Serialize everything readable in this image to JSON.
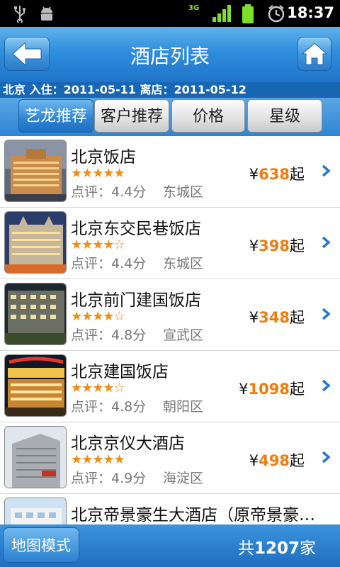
{
  "status_bar": {
    "time": "18:37",
    "network": "3G"
  },
  "header": {
    "title": "酒店列表"
  },
  "info": {
    "text": "北京 入住：2011-05-11 离店：2011-05-12"
  },
  "tabs": [
    {
      "label": "艺龙推荐",
      "active": true
    },
    {
      "label": "客户推荐",
      "active": false
    },
    {
      "label": "价格",
      "active": false
    },
    {
      "label": "星级",
      "active": false
    }
  ],
  "hotels": [
    {
      "name": "北京饭店",
      "stars": "★★★★★",
      "review": "点评：4.4分",
      "district": "东城区",
      "price_prefix": "¥",
      "price": "638",
      "price_suffix": "起"
    },
    {
      "name": "北京东交民巷饭店",
      "stars": "★★★★☆",
      "review": "点评：4.4分",
      "district": "东城区",
      "price_prefix": "¥",
      "price": "398",
      "price_suffix": "起"
    },
    {
      "name": "北京前门建国饭店",
      "stars": "★★★★☆",
      "review": "点评：4.8分",
      "district": "宣武区",
      "price_prefix": "¥",
      "price": "348",
      "price_suffix": "起"
    },
    {
      "name": "北京建国饭店",
      "stars": "★★★★☆",
      "review": "点评：4.8分",
      "district": "朝阳区",
      "price_prefix": "¥",
      "price": "1098",
      "price_suffix": "起"
    },
    {
      "name": "北京京仪大酒店",
      "stars": "★★★★★",
      "review": "点评：4.9分",
      "district": "海淀区",
      "price_prefix": "¥",
      "price": "498",
      "price_suffix": "起"
    },
    {
      "name": "北京帝景豪生大酒店（原帝景豪…"
    }
  ],
  "footer": {
    "map_button": "地图模式",
    "total_prefix": "共",
    "total_count": "1207",
    "total_suffix": "家"
  },
  "colors": {
    "accent": "#2f84d2",
    "price": "#f07c10",
    "stars": "#f28c14"
  }
}
